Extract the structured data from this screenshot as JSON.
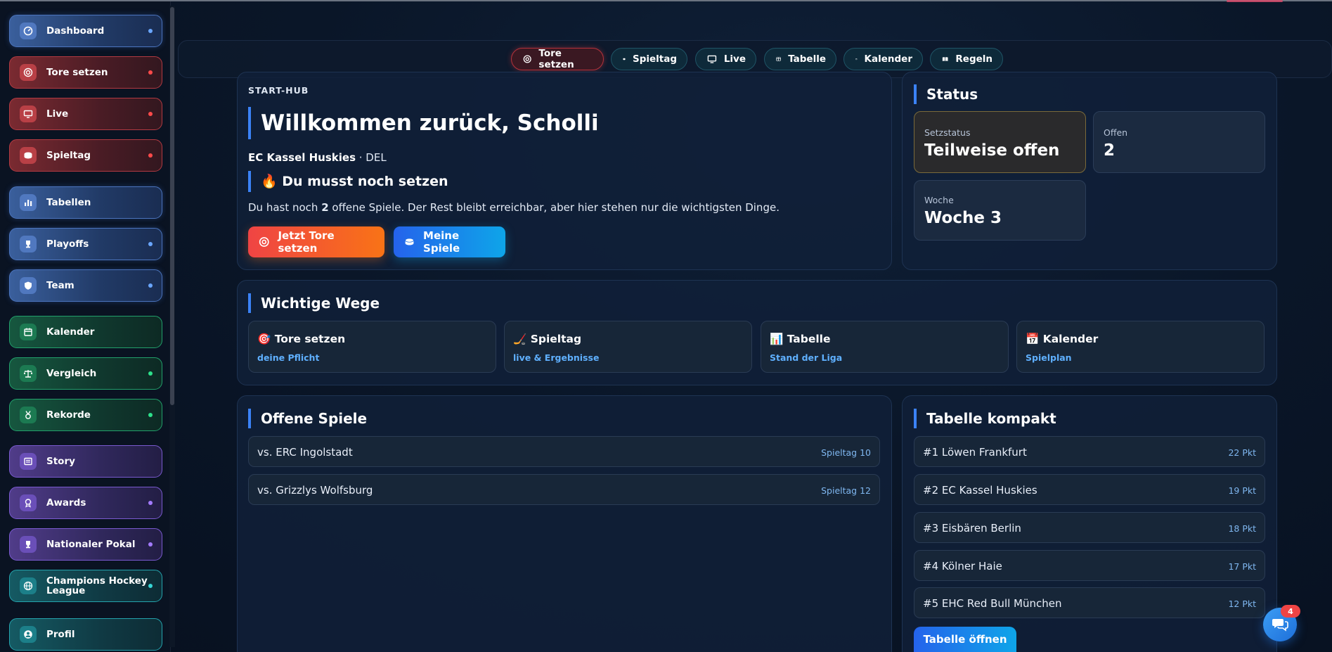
{
  "sidebar": {
    "items": [
      {
        "label": "Dashboard",
        "icon": "gauge-icon",
        "color": "blue"
      },
      {
        "label": "Tore setzen",
        "icon": "target-icon",
        "color": "red"
      },
      {
        "label": "Live",
        "icon": "monitor-icon",
        "color": "red"
      },
      {
        "label": "Spieltag",
        "icon": "puck-icon",
        "color": "red"
      },
      {
        "label": "Tabellen",
        "icon": "bar-chart-icon",
        "color": "blue"
      },
      {
        "label": "Playoffs",
        "icon": "trophy-icon",
        "color": "blue"
      },
      {
        "label": "Team",
        "icon": "shield-icon",
        "color": "blue"
      },
      {
        "label": "Kalender",
        "icon": "calendar-icon",
        "color": "green"
      },
      {
        "label": "Vergleich",
        "icon": "scale-icon",
        "color": "green"
      },
      {
        "label": "Rekorde",
        "icon": "medal-icon",
        "color": "green"
      },
      {
        "label": "Story",
        "icon": "newspaper-icon",
        "color": "purple"
      },
      {
        "label": "Awards",
        "icon": "award-icon",
        "color": "purple"
      },
      {
        "label": "Nationaler Pokal",
        "icon": "cup-icon",
        "color": "purple"
      },
      {
        "label": "Champions Hockey League",
        "icon": "globe-icon",
        "color": "teal"
      },
      {
        "label": "Profil",
        "icon": "user-icon",
        "color": "teal"
      }
    ]
  },
  "topnav": {
    "items": [
      {
        "label": "Tore setzen",
        "icon": "target-icon"
      },
      {
        "label": "Spieltag",
        "icon": "puck-icon"
      },
      {
        "label": "Live",
        "icon": "monitor-icon"
      },
      {
        "label": "Tabelle",
        "icon": "table-icon"
      },
      {
        "label": "Kalender",
        "icon": "calendar-icon"
      },
      {
        "label": "Regeln",
        "icon": "book-icon"
      }
    ]
  },
  "hub": {
    "label": "START-HUB",
    "welcome": "Willkommen zurück, Scholli",
    "team": "EC Kassel Huskies",
    "league": " · DEL",
    "must_title": "🔥 Du musst noch setzen",
    "open_text_pre": "Du hast noch ",
    "open_count": "2",
    "open_text_post": " offene Spiele. Der Rest bleibt erreichbar, aber hier stehen nur die wichtigsten Dinge.",
    "btn_primary": "Jetzt Tore setzen",
    "btn_secondary": "Meine Spiele"
  },
  "status": {
    "title": "Status",
    "setzstatus_label": "Setzstatus",
    "setzstatus_value": "Teilweise offen",
    "offen_label": "Offen",
    "offen_value": "2",
    "woche_label": "Woche",
    "woche_value": "Woche 3"
  },
  "ways": {
    "title": "Wichtige Wege",
    "items": [
      {
        "title": "🎯 Tore setzen",
        "sub": "deine Pflicht"
      },
      {
        "title": "🏒 Spieltag",
        "sub": "live & Ergebnisse"
      },
      {
        "title": "📊 Tabelle",
        "sub": "Stand der Liga"
      },
      {
        "title": "📅 Kalender",
        "sub": "Spielplan"
      }
    ]
  },
  "open_games": {
    "title": "Offene Spiele",
    "items": [
      {
        "opponent": "vs. ERC Ingolstadt",
        "matchday": "Spieltag 10"
      },
      {
        "opponent": "vs. Grizzlys Wolfsburg",
        "matchday": "Spieltag 12"
      }
    ]
  },
  "table": {
    "title": "Tabelle kompakt",
    "rows": [
      {
        "team": "#1 Löwen Frankfurt",
        "points": "22 Pkt"
      },
      {
        "team": "#2 EC Kassel Huskies",
        "points": "19 Pkt"
      },
      {
        "team": "#3 Eisbären Berlin",
        "points": "18 Pkt"
      },
      {
        "team": "#4 Kölner Haie",
        "points": "17 Pkt"
      },
      {
        "team": "#5 EHC Red Bull München",
        "points": "12 Pkt"
      }
    ],
    "button": "Tabelle öffnen"
  },
  "chat": {
    "badge": "4",
    "icon": "chat-icon"
  },
  "colors": {
    "accent": "#3b82f6",
    "orange": "#f97316",
    "red": "#ef4444"
  }
}
